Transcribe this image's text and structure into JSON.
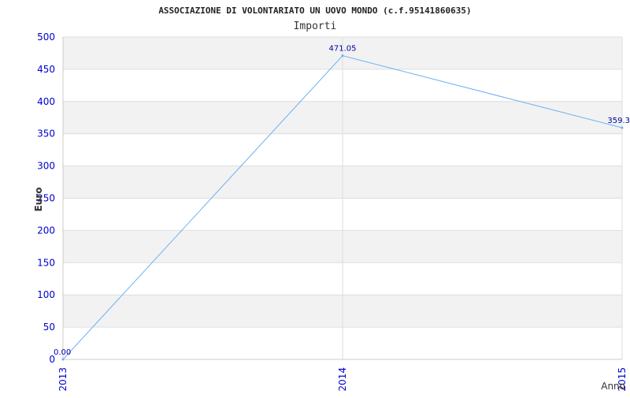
{
  "chart_data": {
    "type": "line",
    "title": "ASSOCIAZIONE DI VOLONTARIATO UN UOVO MONDO (c.f.95141860635)",
    "subtitle": "Importi",
    "xlabel": "Anno",
    "ylabel": "Euro",
    "categories": [
      "2013",
      "2014",
      "2015"
    ],
    "series": [
      {
        "values": [
          0.0,
          471.05,
          359.3
        ],
        "labels": [
          "0.00",
          "471.05",
          "359.3"
        ]
      }
    ],
    "ylim": [
      0,
      500
    ],
    "yticks": [
      0,
      50,
      100,
      150,
      200,
      250,
      300,
      350,
      400,
      450,
      500
    ],
    "grid": true,
    "colors": {
      "line": "#6ab0f5",
      "tick_text": "#0000cc",
      "band": "#f2f2f2",
      "grid": "#dddddd",
      "data_label": "#0000aa"
    }
  }
}
